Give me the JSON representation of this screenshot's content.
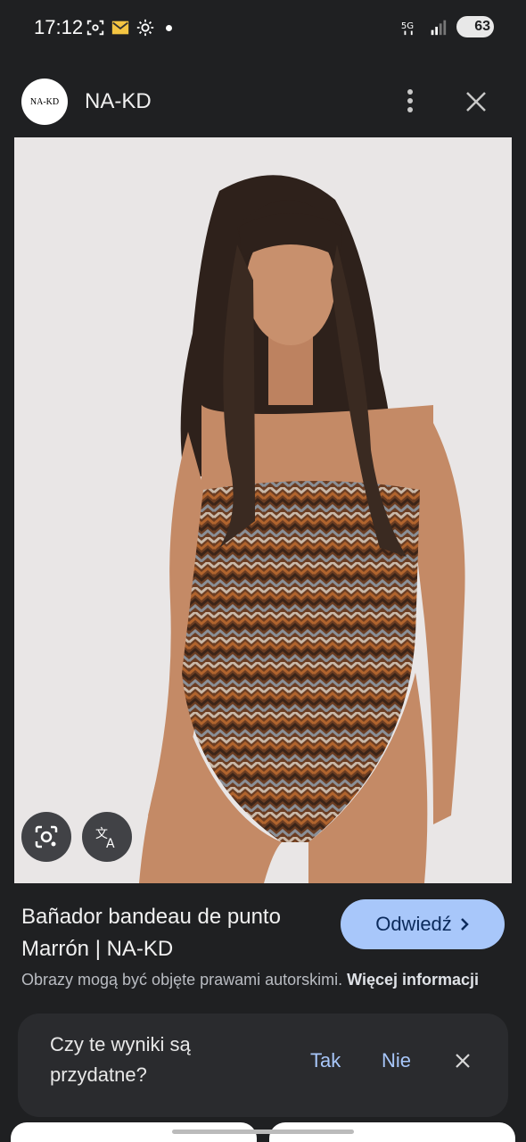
{
  "status": {
    "time": "17:12",
    "battery": "63",
    "network": "5G"
  },
  "header": {
    "logo_text": "NA-KD",
    "site_name": "NA-KD"
  },
  "image": {
    "alt": "Bañador bandeau de punto Marrón | NA-KD"
  },
  "info": {
    "title": "Bañador bandeau de punto Marrón | NA-KD",
    "visit_label": "Odwiedź",
    "copyright_text": "Obrazy mogą być objęte prawami autorskimi.",
    "more_info": "Więcej informacji"
  },
  "feedback": {
    "question": "Czy te wyniki są przydatne?",
    "yes": "Tak",
    "no": "Nie"
  },
  "colors": {
    "accent": "#a8c7fa",
    "background": "#1f2022"
  }
}
